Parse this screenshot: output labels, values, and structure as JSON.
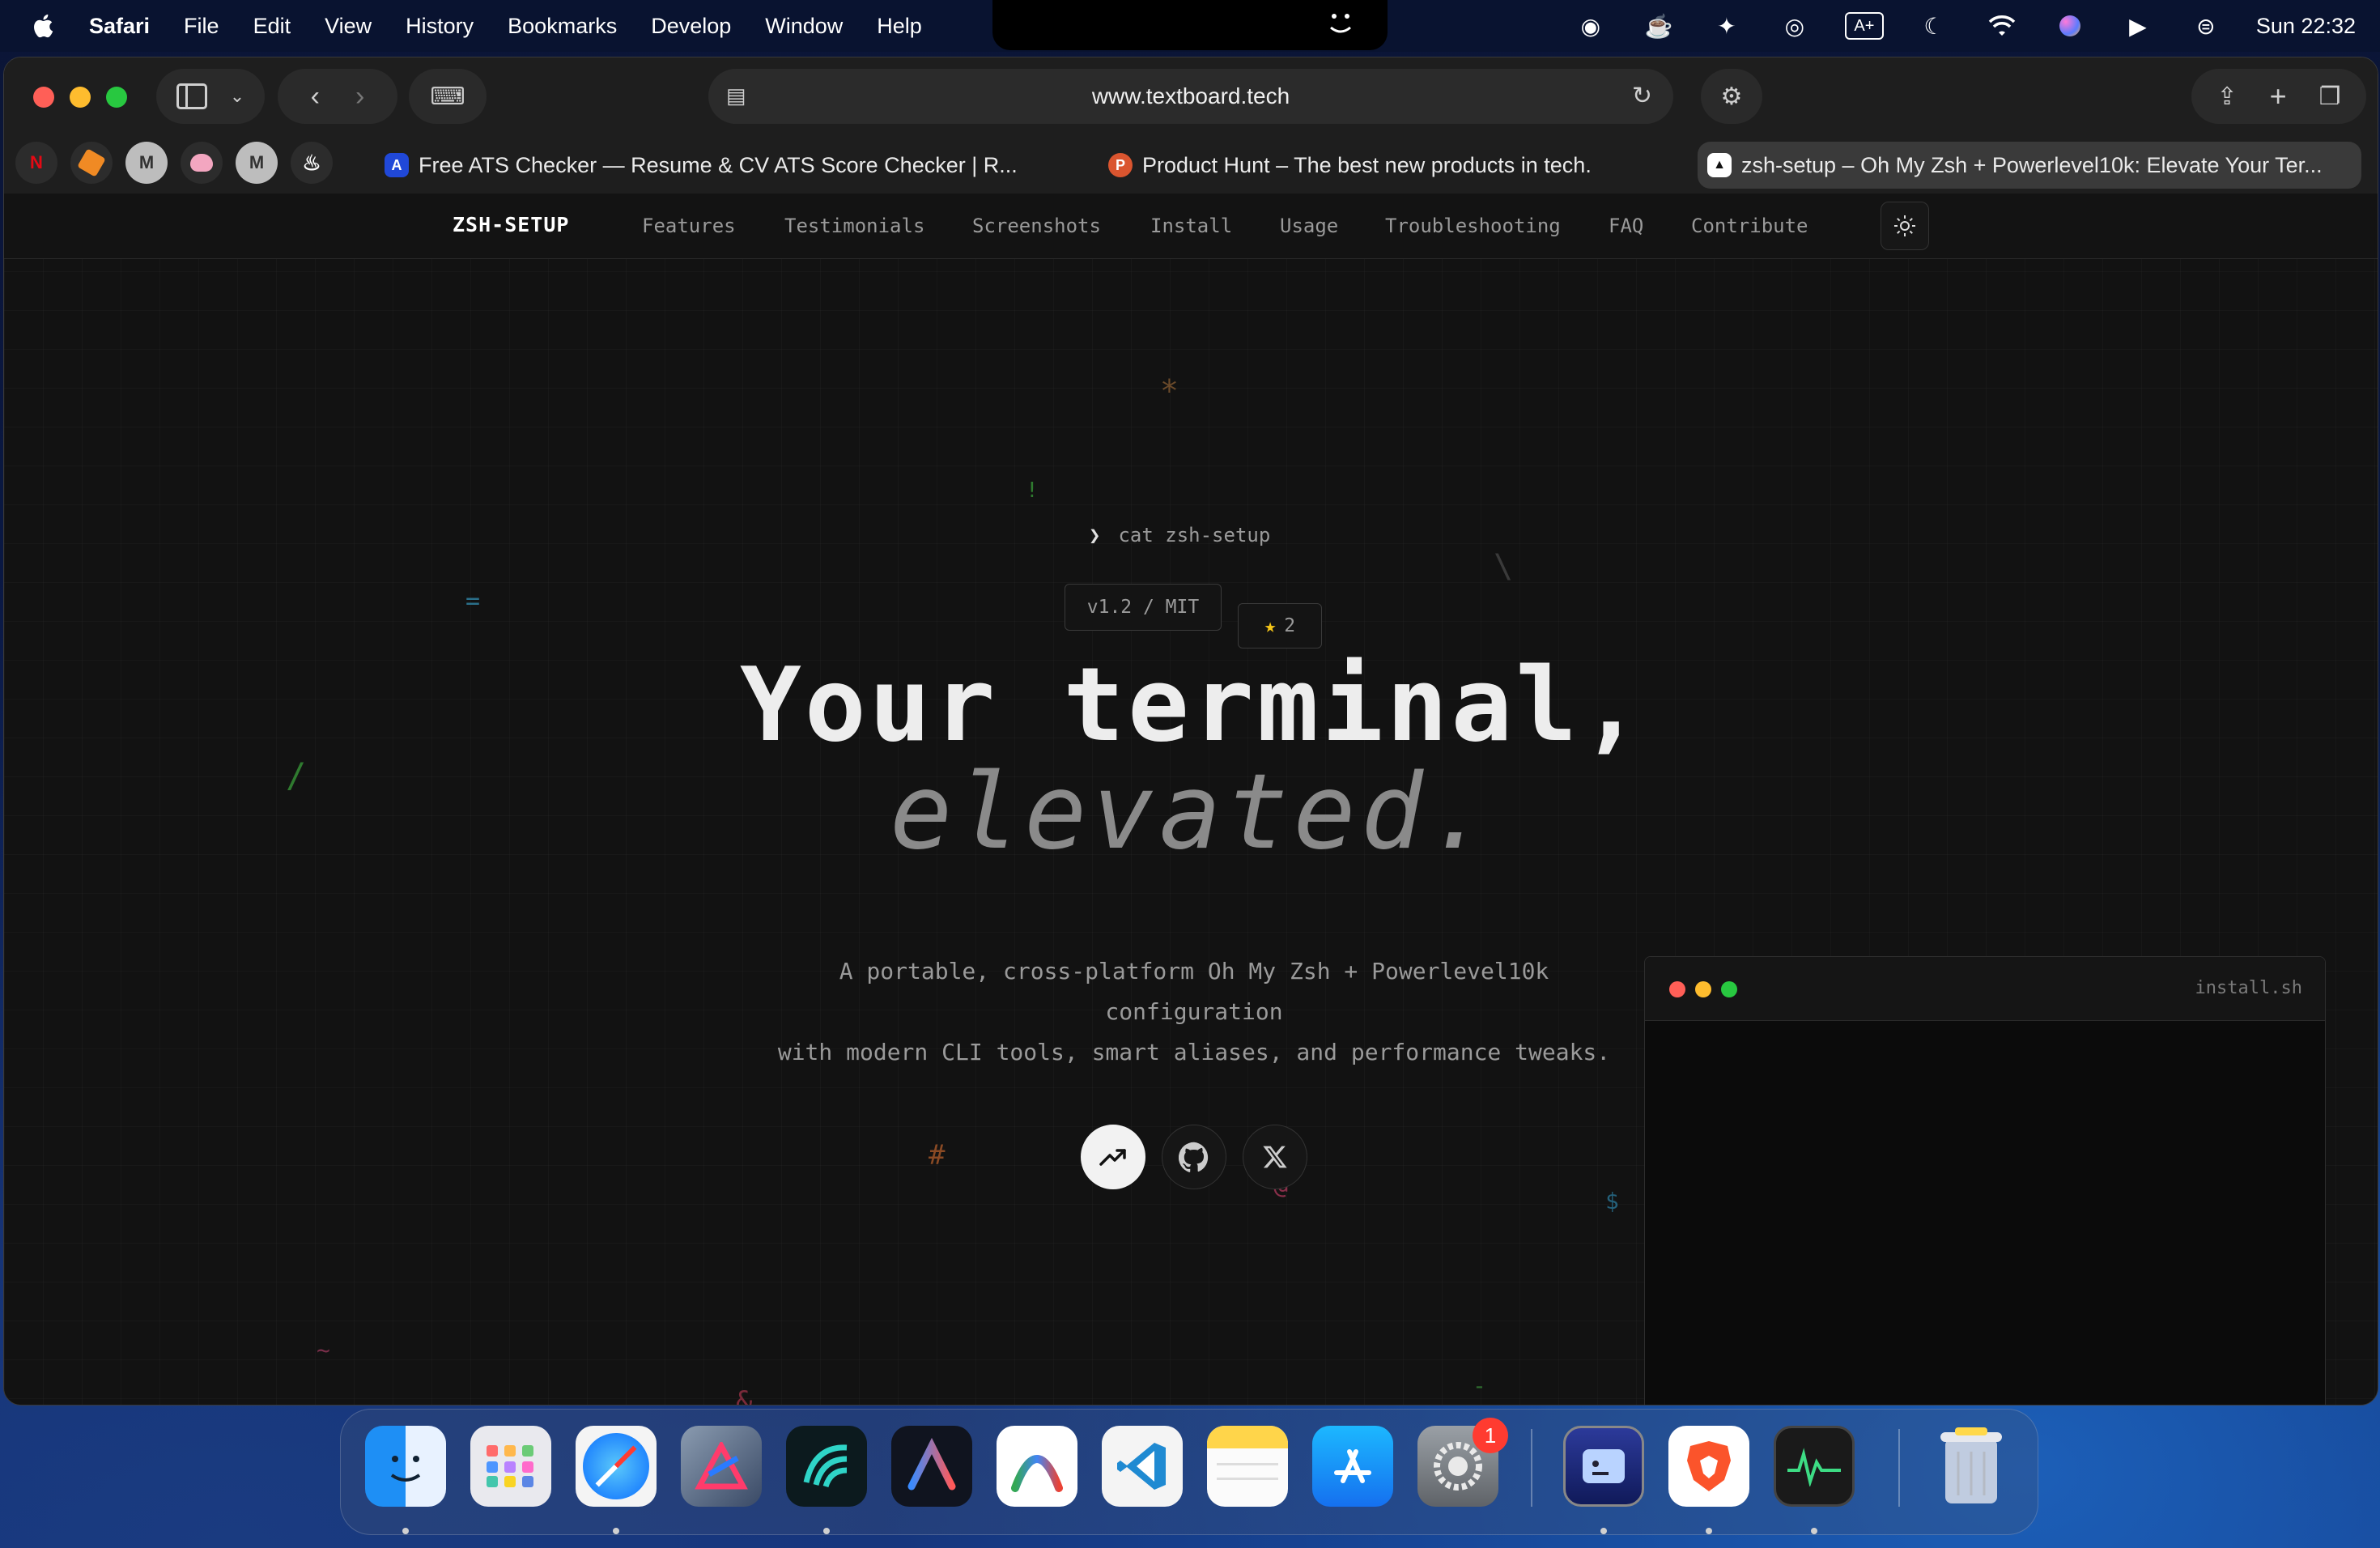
{
  "menubar": {
    "app_name": "Safari",
    "items": [
      "File",
      "Edit",
      "View",
      "History",
      "Bookmarks",
      "Develop",
      "Window",
      "Help"
    ],
    "clock": "Sun 22:32"
  },
  "browser": {
    "url": "www.textboard.tech",
    "favorites": [
      "N",
      "M",
      "M"
    ],
    "tabs": [
      {
        "title": "Free ATS Checker — Resume & CV ATS Score Checker | R...",
        "icon": "A",
        "icon_color": "#2048d8"
      },
      {
        "title": "Product Hunt – The best new products in tech.",
        "icon": "P",
        "icon_color": "#da552f"
      },
      {
        "title": "zsh-setup – Oh My Zsh + Powerlevel10k: Elevate Your Ter...",
        "icon": "▲",
        "icon_color": "#111111"
      }
    ]
  },
  "site": {
    "brand": "ZSH-SETUP",
    "nav": [
      "Features",
      "Testimonials",
      "Screenshots",
      "Install",
      "Usage",
      "Troubleshooting",
      "FAQ",
      "Contribute"
    ],
    "prompt_symbol": "❯",
    "prompt_command": "cat zsh-setup",
    "version_badge": "v1.2 / MIT",
    "stars_icon": "★",
    "stars_count": "2",
    "headline_line1": "Your terminal,",
    "headline_line2": "elevated.",
    "subtitle_line1": "A portable, cross-platform Oh My Zsh + Powerlevel10k",
    "subtitle_line2": "configuration",
    "subtitle_line3": "with modern CLI tools, smart aliases, and performance tweaks.",
    "terminal_title": "install.sh",
    "floating_glyphs": {
      "asterisk": "*",
      "bang": "!",
      "equals": "=",
      "slash": "/",
      "backslash": "\\",
      "hash": "#",
      "at": "@",
      "dollar": "$",
      "tilde": "~",
      "amp": "&",
      "dash": "-"
    }
  },
  "dock": {
    "settings_badge": "1",
    "apps": [
      "finder",
      "launchpad",
      "safari",
      "affinity",
      "warp",
      "arc",
      "antigravity",
      "vscode",
      "notes",
      "app-store",
      "system-settings",
      "terminal",
      "brave",
      "activity-monitor",
      "trash"
    ]
  },
  "colors": {
    "accent_red": "#ff5f57",
    "accent_yellow": "#febc2e",
    "accent_green": "#28c840"
  }
}
